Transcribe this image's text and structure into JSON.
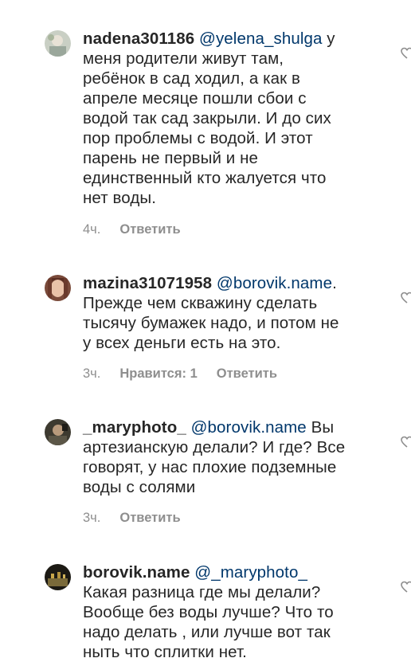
{
  "comments": [
    {
      "username": "nadena301186",
      "mention": "@yelena_shulga",
      "lines": [
        "у",
        "меня родители живут там,",
        "ребёнок в сад ходил, а как в",
        "апреле месяце пошли сбои с",
        "водой так сад закрыли. И до сих",
        "пор проблемы с водой. И этот",
        "парень не первый и не",
        "единственный кто жалуется что",
        "нет воды."
      ],
      "time": "4ч.",
      "likes": "",
      "reply": "Ответить"
    },
    {
      "username": "mazina31071958",
      "mention": "@borovik.name",
      "lines": [
        ".",
        "Прежде чем скважину сделать",
        "тысячу бумажек надо, и потом не",
        "у всех деньги есть на это."
      ],
      "time": "3ч.",
      "likes": "Нравится: 1",
      "reply": "Ответить"
    },
    {
      "username": "_maryphoto_",
      "mention": "@borovik.name",
      "lines": [
        "Вы",
        "артезианскую делали? И где? Все",
        "говорят, у нас плохие подземные",
        "воды с солями"
      ],
      "time": "3ч.",
      "likes": "",
      "reply": "Ответить"
    },
    {
      "username": "borovik.name",
      "mention": "@_maryphoto_",
      "lines": [
        "",
        "Какая разница где мы делали?",
        "Вообще без воды лучше? Что то",
        "надо делать , или лучше вот так",
        "ныть что сплитки нет."
      ],
      "time": "",
      "likes": "",
      "reply": ""
    }
  ],
  "colors": {
    "text": "#262626",
    "mention": "#00376b",
    "meta": "#8e8e8e",
    "background": "#ffffff"
  },
  "icons": {
    "like": "heart-outline-icon"
  }
}
